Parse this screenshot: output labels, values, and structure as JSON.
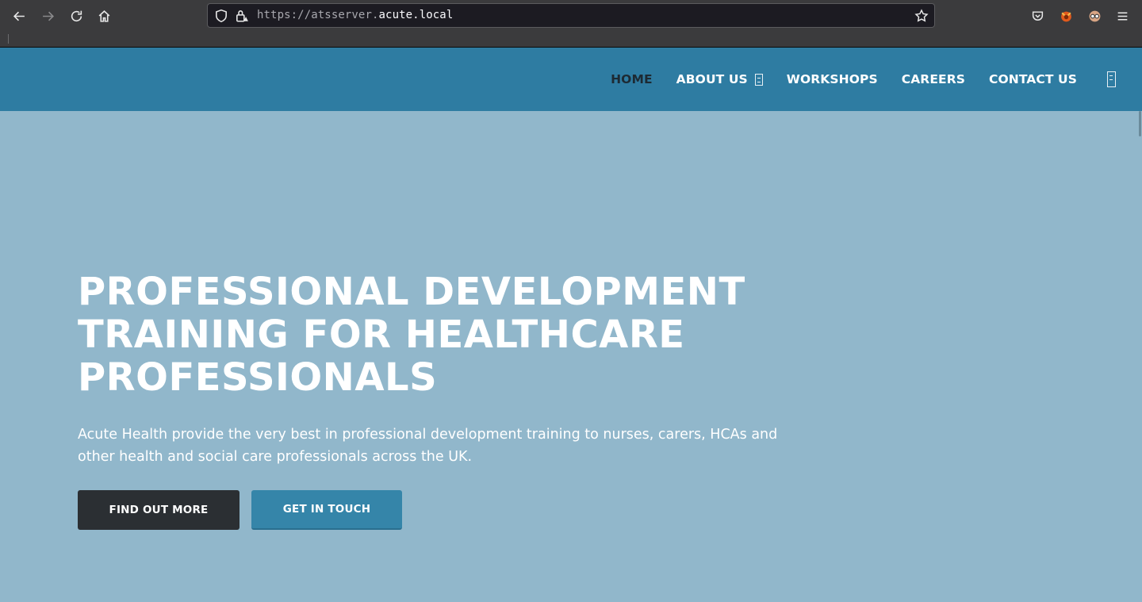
{
  "browser": {
    "url_prefix": "https://atsserver.",
    "url_domain": "acute.local"
  },
  "nav": {
    "home": "HOME",
    "about": "ABOUT US",
    "workshops": "WORKSHOPS",
    "careers": "CAREERS",
    "contact": "CONTACT US"
  },
  "hero": {
    "title_line1": "PROFESSIONAL DEVELOPMENT",
    "title_line2": "TRAINING FOR HEALTHCARE",
    "title_line3": "PROFESSIONALS",
    "text_line1": "Acute Health provide the very best in professional development training to nurses, carers, HCAs and",
    "text_line2": "other health and social care professionals across the UK.",
    "btn_primary": "FIND OUT MORE",
    "btn_secondary": "GET IN TOUCH"
  },
  "colors": {
    "header_bg": "#2e7ca2",
    "hero_bg": "#91b7cb",
    "btn_dark": "#2b2f33",
    "btn_blue": "#3585a9",
    "nav_active": "#1d2a33"
  }
}
